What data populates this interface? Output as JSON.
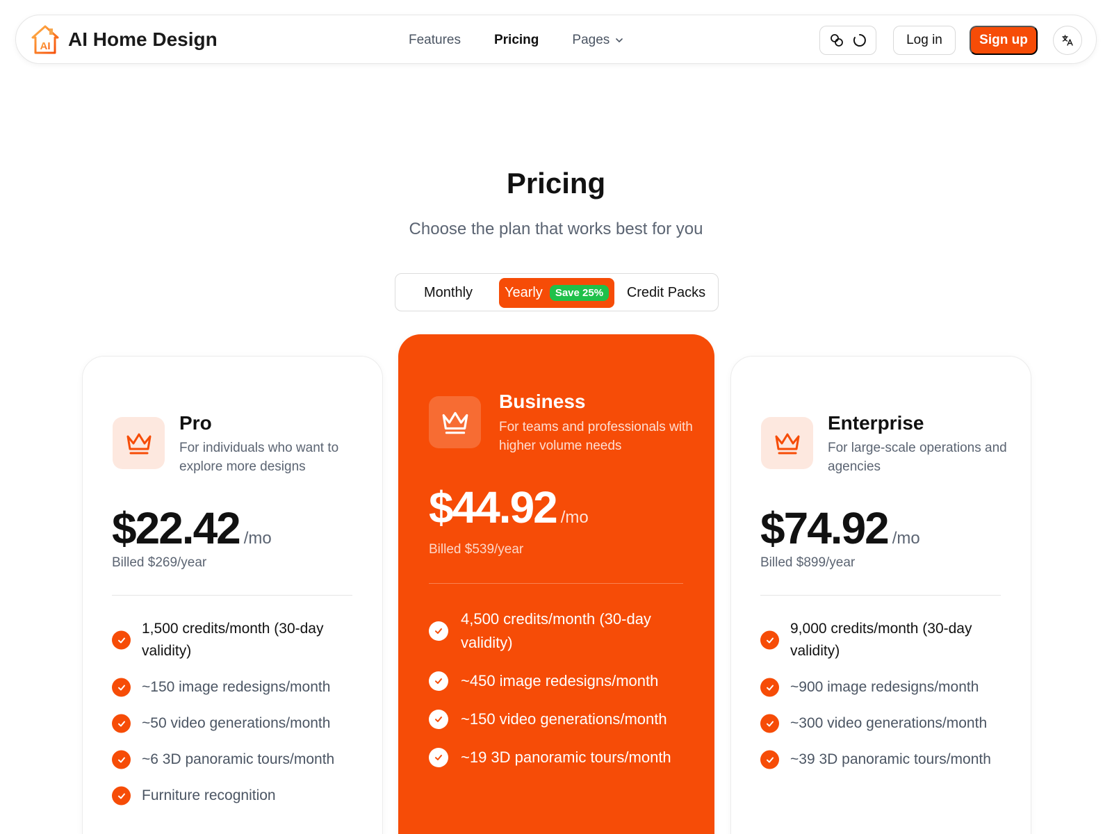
{
  "nav": {
    "brand": "AI Home Design",
    "links": [
      {
        "label": "Features"
      },
      {
        "label": "Pricing"
      },
      {
        "label": "Pages"
      }
    ],
    "login": "Log in",
    "signup": "Sign up"
  },
  "header": {
    "title": "Pricing",
    "subtitle": "Choose the plan that works best for you"
  },
  "billing_toggle": {
    "options": [
      {
        "label": "Monthly"
      },
      {
        "label": "Yearly",
        "badge": "Save 25%",
        "selected": true
      },
      {
        "label": "Credit Packs"
      }
    ]
  },
  "plans": [
    {
      "name": "Pro",
      "description": "For individuals who want to explore more designs",
      "price": "$22.42",
      "per": "/mo",
      "billed": "Billed $269/year",
      "features": [
        "1,500 credits/month (30-day validity)",
        "~150 image redesigns/month",
        "~50 video generations/month",
        "~6 3D panoramic tours/month",
        "Furniture recognition"
      ]
    },
    {
      "name": "Business",
      "description": "For teams and professionals with higher volume needs",
      "price": "$44.92",
      "per": "/mo",
      "billed": "Billed $539/year",
      "features": [
        "4,500 credits/month (30-day validity)",
        "~450 image redesigns/month",
        "~150 video generations/month",
        "~19 3D panoramic tours/month"
      ]
    },
    {
      "name": "Enterprise",
      "description": "For large-scale operations and agencies",
      "price": "$74.92",
      "per": "/mo",
      "billed": "Billed $899/year",
      "features": [
        "9,000 credits/month (30-day validity)",
        "~900 image redesigns/month",
        "~300 video generations/month",
        "~39 3D panoramic tours/month"
      ]
    }
  ],
  "colors": {
    "accent": "#f64c07",
    "badge_green": "#1fc04a",
    "muted_text": "#5b6472"
  },
  "icons": [
    "house-ai-logo-icon",
    "chevron-down-icon",
    "link-icon",
    "loading-spinner-icon",
    "translate-icon",
    "crown-icon",
    "check-circle-icon"
  ]
}
